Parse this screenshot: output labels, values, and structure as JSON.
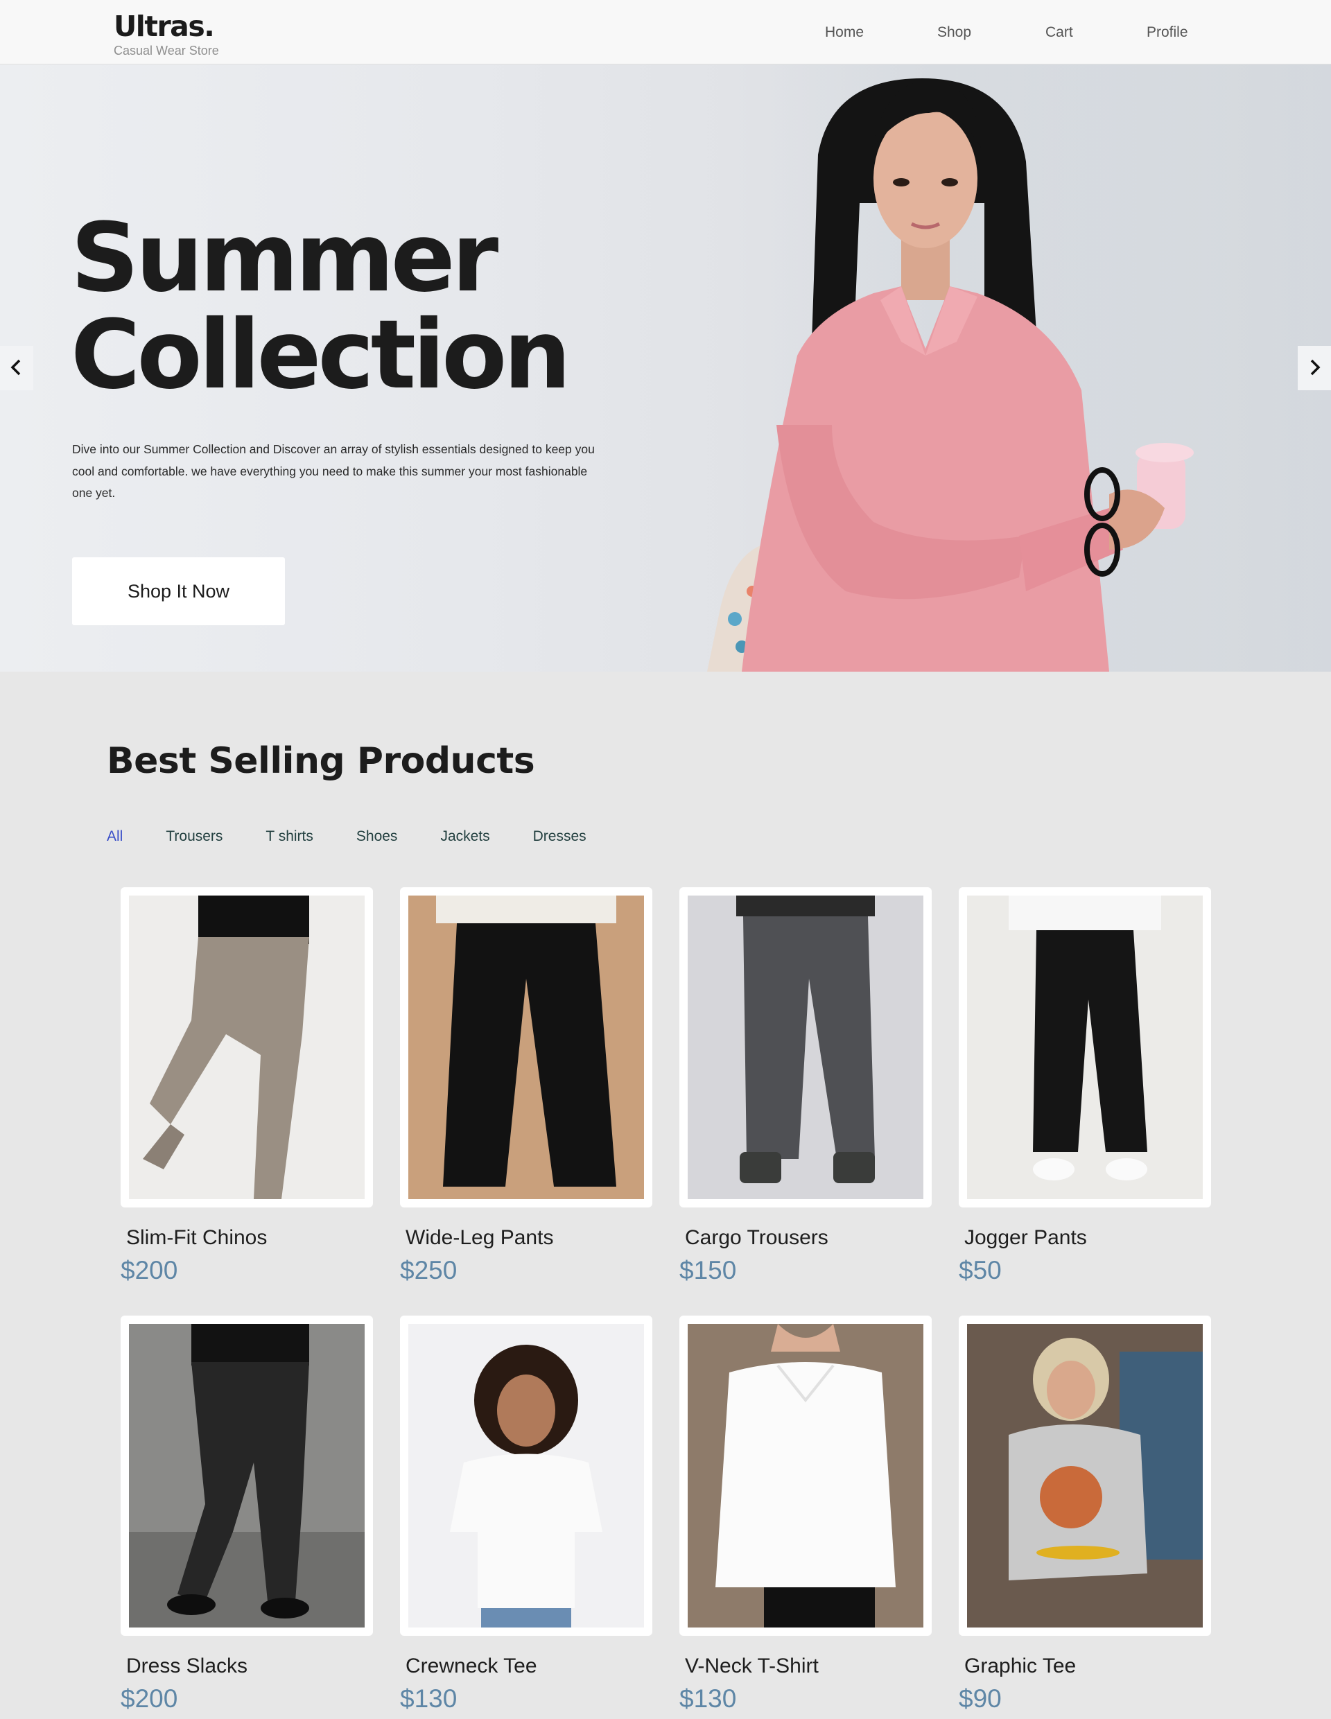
{
  "header": {
    "logo": "Ultras.",
    "tagline": "Casual Wear Store",
    "nav": [
      "Home",
      "Shop",
      "Cart",
      "Profile"
    ]
  },
  "hero": {
    "title": "Summer\nCollection",
    "description": "Dive into our Summer Collection and Discover an array of stylish essentials designed to keep you cool and comfortable. we have everything you need to make this summer your most fashionable one yet.",
    "button": "Shop It Now"
  },
  "products_section": {
    "title": "Best Selling Products",
    "filters": [
      "All",
      "Trousers",
      "T shirts",
      "Shoes",
      "Jackets",
      "Dresses"
    ],
    "active_filter": "All"
  },
  "products": [
    {
      "name": "Slim-Fit Chinos",
      "price": "$200"
    },
    {
      "name": "Wide-Leg Pants",
      "price": "$250"
    },
    {
      "name": "Cargo Trousers",
      "price": "$150"
    },
    {
      "name": "Jogger Pants",
      "price": "$50"
    },
    {
      "name": "Dress Slacks",
      "price": "$200"
    },
    {
      "name": "Crewneck Tee",
      "price": "$130"
    },
    {
      "name": "V-Neck T-Shirt",
      "price": "$130"
    },
    {
      "name": "Graphic Tee",
      "price": "$90"
    }
  ],
  "colors": {
    "accent": "#3b50c8",
    "price": "#5e86a6",
    "page_bg": "#e7e7e7",
    "header_bg": "#f8f8f8"
  }
}
